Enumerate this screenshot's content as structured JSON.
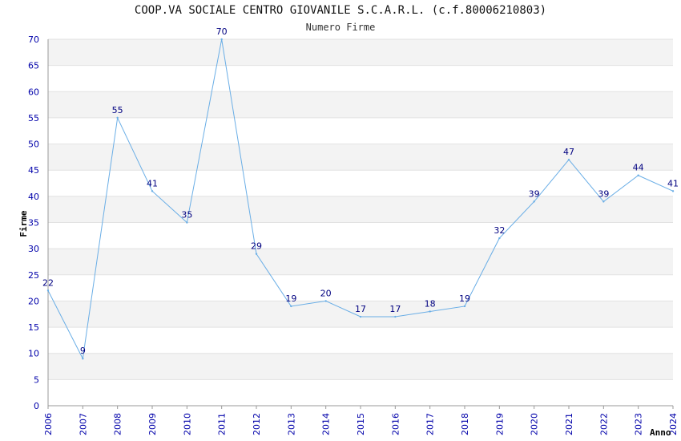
{
  "chart_data": {
    "type": "line",
    "title": "COOP.VA SOCIALE CENTRO GIOVANILE S.C.A.R.L. (c.f.80006210803)",
    "subtitle": "Numero Firme",
    "xlabel": "Anno",
    "ylabel": "Firme",
    "ylim": [
      0,
      70
    ],
    "yticks": [
      0,
      5,
      10,
      15,
      20,
      25,
      30,
      35,
      40,
      45,
      50,
      55,
      60,
      65,
      70
    ],
    "grid": "horizontal alternating bands",
    "categories": [
      "2006",
      "2007",
      "2008",
      "2009",
      "2010",
      "2011",
      "2012",
      "2013",
      "2014",
      "2015",
      "2016",
      "2017",
      "2018",
      "2019",
      "2020",
      "2021",
      "2022",
      "2023",
      "2024"
    ],
    "series": [
      {
        "values": [
          22,
          9,
          55,
          41,
          35,
          70,
          29,
          19,
          20,
          17,
          17,
          18,
          19,
          32,
          39,
          47,
          39,
          44,
          41
        ]
      }
    ],
    "colors": {
      "line": "#6aaee6",
      "band": "#f3f3f3",
      "tick_text": "#0000aa",
      "data_label": "#000080"
    }
  }
}
